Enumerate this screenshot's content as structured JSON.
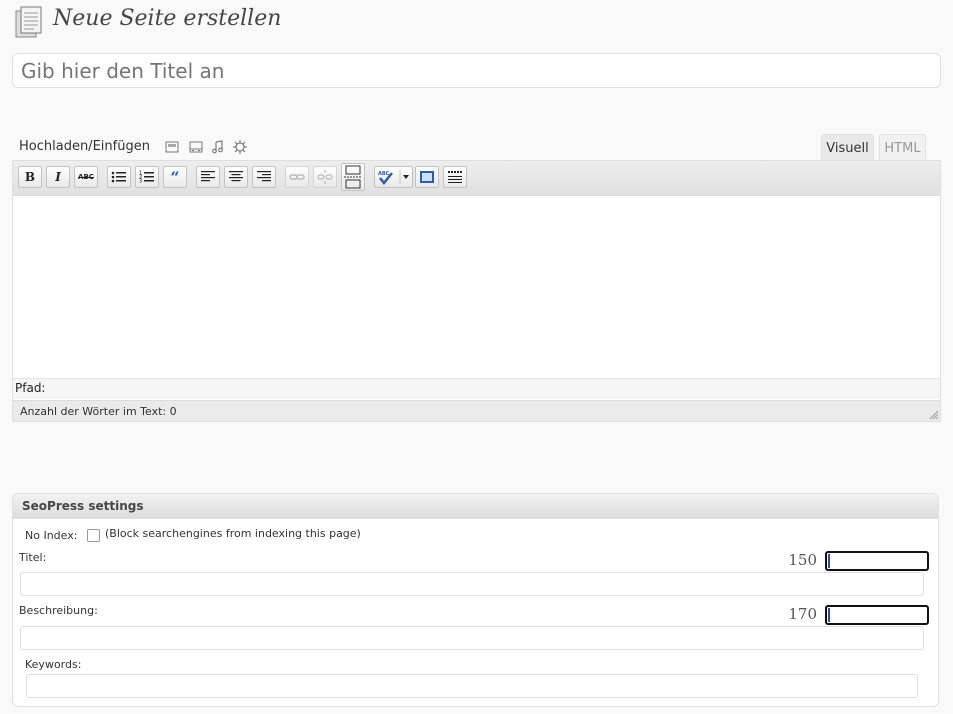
{
  "header": {
    "title": "Neue Seite erstellen"
  },
  "title_input": {
    "placeholder": "Gib hier den Titel an",
    "value": ""
  },
  "media": {
    "label": "Hochladen/Einfügen",
    "icons": [
      "image-icon",
      "video-icon",
      "audio-icon",
      "media-icon"
    ]
  },
  "tabs": {
    "visual": "Visuell",
    "html": "HTML"
  },
  "toolbar": {
    "bold": "B",
    "italic": "I",
    "strikethrough": "ABC"
  },
  "editor": {
    "path_label": "Pfad:",
    "word_count": "Anzahl der Wörter im Text: 0"
  },
  "seo": {
    "heading": "SeoPress settings",
    "noindex_label": "No Index:",
    "noindex_hint": "(Block searchengines from indexing this page)",
    "noindex_checked": false,
    "title_label": "Titel:",
    "title_counter": "150",
    "title_value": "",
    "description_label": "Beschreibung:",
    "description_counter": "170",
    "description_value": "",
    "keywords_label": "Keywords:",
    "keywords_value": ""
  }
}
